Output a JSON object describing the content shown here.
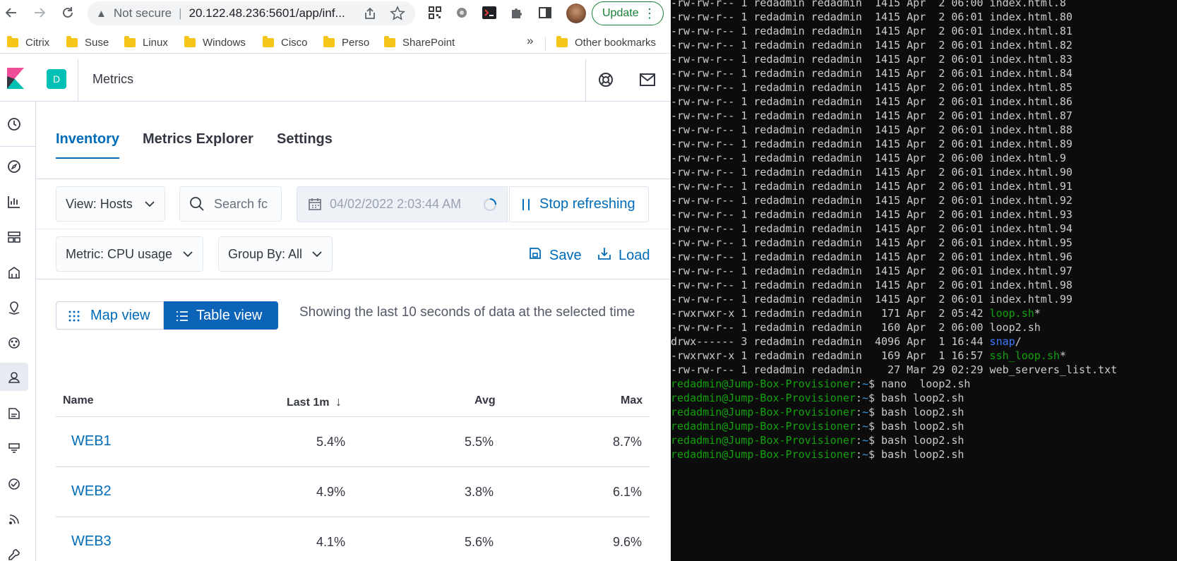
{
  "browser": {
    "security_label": "Not secure",
    "url": "20.122.48.236:5601/app/inf...",
    "update_label": "Update",
    "bookmarks": [
      "Citrix",
      "Suse",
      "Linux",
      "Windows",
      "Cisco",
      "Perso",
      "SharePoint"
    ],
    "more_bookmarks": "»",
    "other_bookmarks": "Other bookmarks"
  },
  "kibana": {
    "space_initial": "D",
    "app_title": "Metrics",
    "tabs": [
      "Inventory",
      "Metrics Explorer",
      "Settings"
    ],
    "active_tab": "Inventory",
    "view_select": "View: Hosts",
    "search_placeholder": "Search fc",
    "date_time": "04/02/2022 2:03:44 AM",
    "stop_refreshing": "Stop refreshing",
    "metric_select": "Metric: CPU usage",
    "group_by_select": "Group By: All",
    "save_label": "Save",
    "load_label": "Load",
    "map_view_label": "Map view",
    "table_view_label": "Table view",
    "info_note": "Showing the last 10 seconds of data at the selected time",
    "table": {
      "headers": [
        "Name",
        "Last 1m",
        "Avg",
        "Max"
      ],
      "sort_indicator": "↓",
      "rows": [
        {
          "name": "WEB1",
          "last": "5.4%",
          "avg": "5.5%",
          "max": "8.7%"
        },
        {
          "name": "WEB2",
          "last": "4.9%",
          "avg": "3.8%",
          "max": "6.1%"
        },
        {
          "name": "WEB3",
          "last": "4.1%",
          "avg": "5.6%",
          "max": "9.6%"
        }
      ]
    }
  },
  "terminal": {
    "lines": [
      {
        "text": "-rw-rw-r-- 1 redadmin redadmin  1415 Apr  2 06:00 index.html.8",
        "parts": null
      },
      {
        "text": "-rw-rw-r-- 1 redadmin redadmin  1415 Apr  2 06:01 index.html.80",
        "parts": null
      },
      {
        "text": "-rw-rw-r-- 1 redadmin redadmin  1415 Apr  2 06:01 index.html.81",
        "parts": null
      },
      {
        "text": "-rw-rw-r-- 1 redadmin redadmin  1415 Apr  2 06:01 index.html.82",
        "parts": null
      },
      {
        "text": "-rw-rw-r-- 1 redadmin redadmin  1415 Apr  2 06:01 index.html.83",
        "parts": null
      },
      {
        "text": "-rw-rw-r-- 1 redadmin redadmin  1415 Apr  2 06:01 index.html.84",
        "parts": null
      },
      {
        "text": "-rw-rw-r-- 1 redadmin redadmin  1415 Apr  2 06:01 index.html.85",
        "parts": null
      },
      {
        "text": "-rw-rw-r-- 1 redadmin redadmin  1415 Apr  2 06:01 index.html.86",
        "parts": null
      },
      {
        "text": "-rw-rw-r-- 1 redadmin redadmin  1415 Apr  2 06:01 index.html.87",
        "parts": null
      },
      {
        "text": "-rw-rw-r-- 1 redadmin redadmin  1415 Apr  2 06:01 index.html.88",
        "parts": null
      },
      {
        "text": "-rw-rw-r-- 1 redadmin redadmin  1415 Apr  2 06:01 index.html.89",
        "parts": null
      },
      {
        "text": "-rw-rw-r-- 1 redadmin redadmin  1415 Apr  2 06:00 index.html.9",
        "parts": null
      },
      {
        "text": "-rw-rw-r-- 1 redadmin redadmin  1415 Apr  2 06:01 index.html.90",
        "parts": null
      },
      {
        "text": "-rw-rw-r-- 1 redadmin redadmin  1415 Apr  2 06:01 index.html.91",
        "parts": null
      },
      {
        "text": "-rw-rw-r-- 1 redadmin redadmin  1415 Apr  2 06:01 index.html.92",
        "parts": null
      },
      {
        "text": "-rw-rw-r-- 1 redadmin redadmin  1415 Apr  2 06:01 index.html.93",
        "parts": null
      },
      {
        "text": "-rw-rw-r-- 1 redadmin redadmin  1415 Apr  2 06:01 index.html.94",
        "parts": null
      },
      {
        "text": "-rw-rw-r-- 1 redadmin redadmin  1415 Apr  2 06:01 index.html.95",
        "parts": null
      },
      {
        "text": "-rw-rw-r-- 1 redadmin redadmin  1415 Apr  2 06:01 index.html.96",
        "parts": null
      },
      {
        "text": "-rw-rw-r-- 1 redadmin redadmin  1415 Apr  2 06:01 index.html.97",
        "parts": null
      },
      {
        "text": "-rw-rw-r-- 1 redadmin redadmin  1415 Apr  2 06:01 index.html.98",
        "parts": null
      },
      {
        "text": "-rw-rw-r-- 1 redadmin redadmin  1415 Apr  2 06:01 index.html.99",
        "parts": null
      },
      {
        "text": null,
        "parts": [
          {
            "t": "-rwxrwxr-x 1 redadmin redadmin   171 Apr  2 05:42 ",
            "c": ""
          },
          {
            "t": "loop.sh",
            "c": "t-green"
          },
          {
            "t": "*",
            "c": ""
          }
        ]
      },
      {
        "text": "-rw-rw-r-- 1 redadmin redadmin   160 Apr  2 06:00 loop2.sh",
        "parts": null
      },
      {
        "text": null,
        "parts": [
          {
            "t": "drwx------ 3 redadmin redadmin  4096 Apr  1 16:44 ",
            "c": ""
          },
          {
            "t": "snap",
            "c": "t-blue"
          },
          {
            "t": "/",
            "c": ""
          }
        ]
      },
      {
        "text": null,
        "parts": [
          {
            "t": "-rwxrwxr-x 1 redadmin redadmin   169 Apr  1 16:57 ",
            "c": ""
          },
          {
            "t": "ssh_loop.sh",
            "c": "t-green"
          },
          {
            "t": "*",
            "c": ""
          }
        ]
      },
      {
        "text": "-rw-rw-r-- 1 redadmin redadmin    27 Mar 29 02:29 web_servers_list.txt",
        "parts": null
      },
      {
        "text": null,
        "parts": [
          {
            "t": "redadmin@Jump-Box-Provisioner",
            "c": "t-green"
          },
          {
            "t": ":",
            "c": ""
          },
          {
            "t": "~",
            "c": "t-cyan"
          },
          {
            "t": "$ nano  loop2.sh",
            "c": ""
          }
        ]
      },
      {
        "text": null,
        "parts": [
          {
            "t": "redadmin@Jump-Box-Provisioner",
            "c": "t-green"
          },
          {
            "t": ":",
            "c": ""
          },
          {
            "t": "~",
            "c": "t-cyan"
          },
          {
            "t": "$ bash loop2.sh",
            "c": ""
          }
        ]
      },
      {
        "text": null,
        "parts": [
          {
            "t": "redadmin@Jump-Box-Provisioner",
            "c": "t-green"
          },
          {
            "t": ":",
            "c": ""
          },
          {
            "t": "~",
            "c": "t-cyan"
          },
          {
            "t": "$ bash loop2.sh",
            "c": ""
          }
        ]
      },
      {
        "text": null,
        "parts": [
          {
            "t": "redadmin@Jump-Box-Provisioner",
            "c": "t-green"
          },
          {
            "t": ":",
            "c": ""
          },
          {
            "t": "~",
            "c": "t-cyan"
          },
          {
            "t": "$ bash loop2.sh",
            "c": ""
          }
        ]
      },
      {
        "text": null,
        "parts": [
          {
            "t": "redadmin@Jump-Box-Provisioner",
            "c": "t-green"
          },
          {
            "t": ":",
            "c": ""
          },
          {
            "t": "~",
            "c": "t-cyan"
          },
          {
            "t": "$ bash loop2.sh",
            "c": ""
          }
        ]
      },
      {
        "text": null,
        "parts": [
          {
            "t": "redadmin@Jump-Box-Provisioner",
            "c": "t-green"
          },
          {
            "t": ":",
            "c": ""
          },
          {
            "t": "~",
            "c": "t-cyan"
          },
          {
            "t": "$ bash loop2.sh",
            "c": ""
          }
        ]
      }
    ]
  },
  "colors": {
    "kibana_link": "#006bb8",
    "primary_button": "#0b64b8",
    "space_badge": "#00bfb3",
    "terminal_bg": "#0c0c0c",
    "terminal_green": "#13a10e",
    "update_green": "#188038"
  }
}
